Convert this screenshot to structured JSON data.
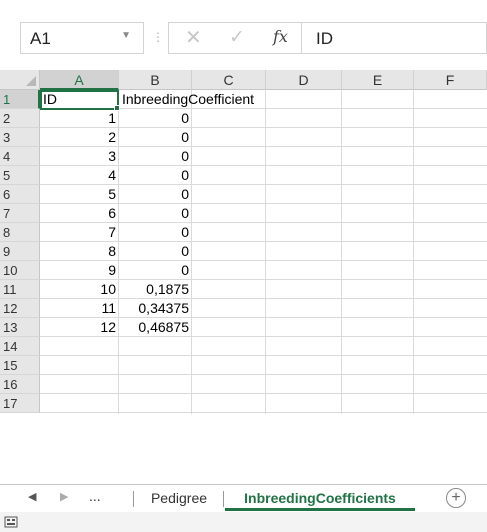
{
  "formula_bar": {
    "name_box": "A1",
    "formula": "ID",
    "icons": [
      "dropdown-caret-icon",
      "cancel-icon",
      "enter-icon",
      "insert-function-icon"
    ]
  },
  "grid": {
    "columns": [
      "A",
      "B",
      "C",
      "D",
      "E",
      "F"
    ],
    "rows": [
      "1",
      "2",
      "3",
      "4",
      "5",
      "6",
      "7",
      "8",
      "9",
      "10",
      "11",
      "12",
      "13",
      "14",
      "15",
      "16",
      "17"
    ],
    "selected_cell": "A1",
    "cells": {
      "a1": "ID",
      "b1": "InbreedingCoefficient",
      "a": [
        "1",
        "2",
        "3",
        "4",
        "5",
        "6",
        "7",
        "8",
        "9",
        "10",
        "11",
        "12"
      ],
      "b": [
        "0",
        "0",
        "0",
        "0",
        "0",
        "0",
        "0",
        "0",
        "0",
        "0,1875",
        "0,34375",
        "0,46875"
      ]
    }
  },
  "sheets": {
    "more": "...",
    "tabs": [
      "Pedigree",
      "InbreedingCoefficients"
    ],
    "active": "InbreedingCoefficients",
    "add_icon": "plus-circle-icon"
  },
  "status": {
    "icon": "cell-mode-icon"
  },
  "colors": {
    "accent": "#217346",
    "header_bg": "#e6e6e6",
    "gridline": "#dadada"
  }
}
